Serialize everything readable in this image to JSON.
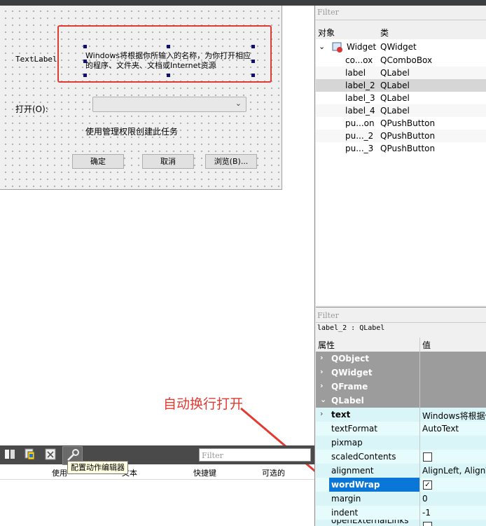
{
  "form": {
    "text_label": "TextLabel",
    "wrapped_label": "Windows将根据你所输入的名称，为你打开相应的程序、文件夹、文档或Internet资源",
    "open_label": "打开(O):",
    "admin_label": "使用管理权限创建此任务",
    "buttons": {
      "ok": "确定",
      "cancel": "取消",
      "browse": "浏览(B)..."
    }
  },
  "annotation": {
    "text": "自动换行打开",
    "color": "#e03b30"
  },
  "object_inspector": {
    "filter_placeholder": "Filter",
    "col_object": "对象",
    "col_class": "类",
    "root": {
      "name": "Widget",
      "class": "QWidget"
    },
    "children": [
      {
        "name": "co...ox",
        "class": "QComboBox"
      },
      {
        "name": "label",
        "class": "QLabel"
      },
      {
        "name": "label_2",
        "class": "QLabel"
      },
      {
        "name": "label_3",
        "class": "QLabel"
      },
      {
        "name": "label_4",
        "class": "QLabel"
      },
      {
        "name": "pu...on",
        "class": "QPushButton"
      },
      {
        "name": "pu..._2",
        "class": "QPushButton"
      },
      {
        "name": "pu..._3",
        "class": "QPushButton"
      }
    ]
  },
  "property_editor": {
    "filter_placeholder": "Filter",
    "context": "label_2 : QLabel",
    "col_property": "属性",
    "col_value": "值",
    "groups": [
      "QObject",
      "QWidget",
      "QFrame",
      "QLabel"
    ],
    "rows": [
      {
        "name": "text",
        "value": "Windows将根据你"
      },
      {
        "name": "textFormat",
        "value": "AutoText"
      },
      {
        "name": "pixmap",
        "value": ""
      },
      {
        "name": "scaledContents",
        "value": ""
      },
      {
        "name": "alignment",
        "value": "AlignLeft, AlignV"
      },
      {
        "name": "wordWrap",
        "value": ""
      },
      {
        "name": "margin",
        "value": "0"
      },
      {
        "name": "indent",
        "value": "-1"
      },
      {
        "name": "openExternalLinks",
        "value": ""
      }
    ]
  },
  "action_editor": {
    "filter_placeholder": "Filter",
    "tooltip": "配置动作编辑器",
    "headers": [
      "使用",
      "文本",
      "快捷键",
      "可选的"
    ]
  }
}
